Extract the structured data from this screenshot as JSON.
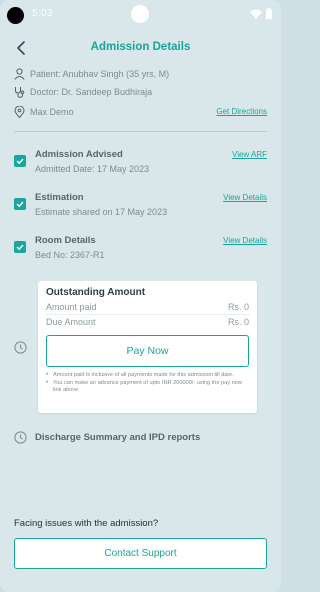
{
  "status_bar": {
    "time": "5:03"
  },
  "header": {
    "title": "Admission Details"
  },
  "patient": {
    "patient_line": "Patient: Anubhav Singh (35 yrs, M)",
    "doctor_line": "Doctor: Dr. Sandeep Budhiraja",
    "hospital": "Max Demo",
    "directions_label": "Get Directions"
  },
  "steps": [
    {
      "title": "Admission Advised",
      "subtitle": "Admitted Date: 17 May 2023",
      "link": "View ARF"
    },
    {
      "title": "Estimation",
      "subtitle": "Estimate shared on 17 May 2023",
      "link": "View Details"
    },
    {
      "title": "Room Details",
      "subtitle": "Bed No: 2367-R1",
      "link": "View Details"
    }
  ],
  "outstanding": {
    "title": "Outstanding Amount",
    "amount_paid_label": "Amount paid",
    "amount_paid_value": "Rs. 0",
    "due_amount_label": "Due Amount",
    "due_amount_value": "Rs. 0",
    "pay_now_label": "Pay Now",
    "notes": [
      "Amount paid is inclusive of all payments made for this admission till date.",
      "You can make an advance payment of upto INR 200000/- using the pay now link above"
    ]
  },
  "discharge": {
    "label": "Discharge Summary and IPD reports"
  },
  "support": {
    "prompt": "Facing issues with the admission?",
    "button_label": "Contact Support"
  },
  "colors": {
    "accent": "#1aa39a",
    "background": "#d9e7ea"
  }
}
